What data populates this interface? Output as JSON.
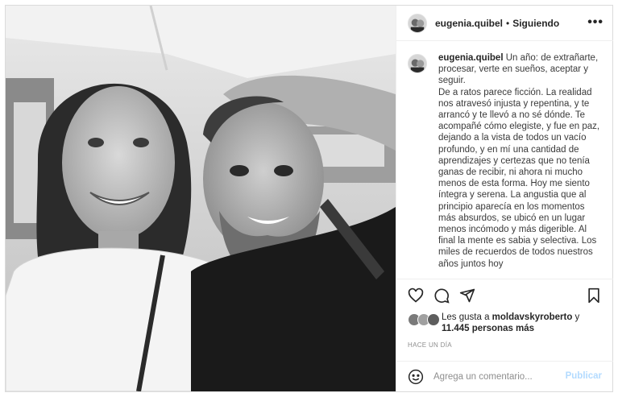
{
  "post": {
    "photo_alt": "",
    "author": "eugenia.quibel",
    "separator": "•",
    "follow_status": "Siguiendo",
    "more_icon": "more-horizontal-icon"
  },
  "caption": {
    "author": "eugenia.quibel",
    "text": "Un año: de extrañarte, procesar, verte en sueños, aceptar y seguir.\nDe a ratos parece ficción. La realidad nos atravesó injusta y repentina, y te arrancó y te llevó a no sé dónde. Te acompañé cómo elegiste, y fue en paz, dejando a la vista de todos un vacío profundo, y en mí una cantidad de aprendizajes y certezas que no tenía ganas de recibir, ni ahora ni mucho menos de esta forma. Hoy me siento íntegra y serena. La angustia que al principio aparecía en los momentos más absurdos, se ubicó en un lugar menos incómodo y más digerible. Al final la mente es sabia y selectiva. Los miles de recuerdos de todos nuestros años juntos hoy"
  },
  "actions": {
    "like_icon": "heart-icon",
    "comment_icon": "comment-icon",
    "share_icon": "send-icon",
    "save_icon": "bookmark-icon"
  },
  "likes": {
    "prefix": "Les gusta a ",
    "user": "moldavskyroberto",
    "middle": " y ",
    "count": "11.445 personas más"
  },
  "timestamp": "Hace un día",
  "comment_box": {
    "emoji_icon": "smiley-icon",
    "placeholder": "Agrega un comentario...",
    "publish_label": "Publicar",
    "publish_color": "#b3dbff"
  }
}
